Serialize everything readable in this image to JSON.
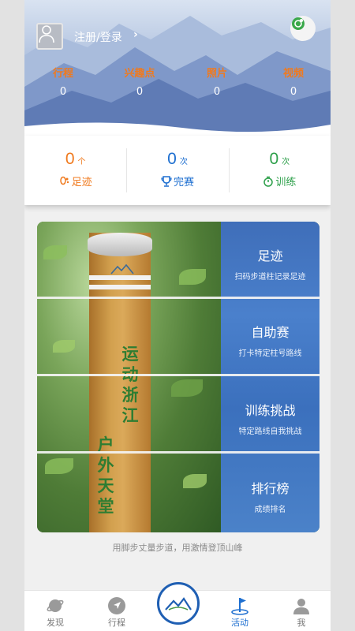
{
  "header": {
    "login_label": "注册/登录",
    "stats": [
      {
        "label": "行程",
        "value": "0"
      },
      {
        "label": "兴趣点",
        "value": "0"
      },
      {
        "label": "照片",
        "value": "0"
      },
      {
        "label": "视频",
        "value": "0"
      }
    ]
  },
  "summary": [
    {
      "value": "0",
      "unit": "个",
      "label": "足迹",
      "color": "#f07a1e",
      "icon": "footprint-icon"
    },
    {
      "value": "0",
      "unit": "次",
      "label": "完赛",
      "color": "#1e6fd0",
      "icon": "trophy-icon"
    },
    {
      "value": "0",
      "unit": "次",
      "label": "训练",
      "color": "#2ea04b",
      "icon": "stopwatch-icon"
    }
  ],
  "post": {
    "text_top": "运动浙江",
    "text_bottom": "户外天堂"
  },
  "tiles": [
    {
      "title": "足迹",
      "subtitle": "扫码步道柱记录足迹"
    },
    {
      "title": "自助赛",
      "subtitle": "打卡特定柱号路线"
    },
    {
      "title": "训练挑战",
      "subtitle": "特定路线自我挑战"
    },
    {
      "title": "排行榜",
      "subtitle": "成绩排名"
    }
  ],
  "slogan": "用脚步丈量步道，用激情登顶山峰",
  "nav": [
    {
      "label": "发现",
      "icon": "planet-icon"
    },
    {
      "label": "行程",
      "icon": "navigation-arrow-icon"
    },
    {
      "label": "活动",
      "icon": "flag-icon",
      "active": true
    },
    {
      "label": "我",
      "icon": "person-icon"
    }
  ],
  "colors": {
    "accent_orange": "#f07a1e",
    "accent_blue": "#1e6fd0",
    "accent_green": "#2ea04b",
    "nav_active": "#1e6fd0"
  }
}
